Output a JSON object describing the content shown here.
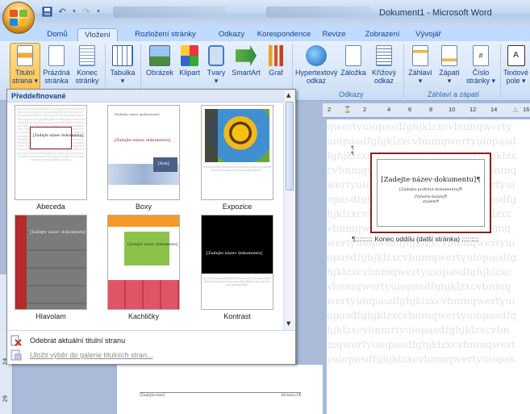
{
  "window": {
    "title": "Dokument1 - Microsoft Word"
  },
  "tabs": [
    {
      "label": "Domů"
    },
    {
      "label": "Vložení"
    },
    {
      "label": "Rozložení stránky"
    },
    {
      "label": "Odkazy"
    },
    {
      "label": "Korespondence"
    },
    {
      "label": "Revize"
    },
    {
      "label": "Zobrazení"
    },
    {
      "label": "Vývojář"
    }
  ],
  "ribbon": {
    "buttons": [
      {
        "line1": "Titulní",
        "line2": "strana ▾"
      },
      {
        "line1": "Prázdná",
        "line2": "stránka"
      },
      {
        "line1": "Konec",
        "line2": "stránky"
      },
      {
        "line1": "Tabulka",
        "line2": "▾"
      },
      {
        "line1": "Obrázek",
        "line2": ""
      },
      {
        "line1": "Klipart",
        "line2": ""
      },
      {
        "line1": "Tvary",
        "line2": "▾"
      },
      {
        "line1": "SmartArt",
        "line2": ""
      },
      {
        "line1": "Graf",
        "line2": ""
      },
      {
        "line1": "Hypertextový",
        "line2": "odkaz"
      },
      {
        "line1": "Záložka",
        "line2": ""
      },
      {
        "line1": "Křížový",
        "line2": "odkaz"
      },
      {
        "line1": "Záhlaví",
        "line2": "▾"
      },
      {
        "line1": "Zápatí",
        "line2": "▾"
      },
      {
        "line1": "Číslo",
        "line2": "stránky ▾"
      },
      {
        "line1": "Textové",
        "line2": "pole ▾"
      }
    ],
    "groups": [
      {
        "label": "Odkazy"
      },
      {
        "label": "Záhlaví a zápatí"
      }
    ]
  },
  "gallery": {
    "header": "Předdefinované",
    "items": [
      {
        "caption": "Abeceda"
      },
      {
        "caption": "Boxy"
      },
      {
        "caption": "Expozice"
      },
      {
        "caption": "Hlavolam"
      },
      {
        "caption": "Kachličky"
      },
      {
        "caption": "Kontrast"
      }
    ],
    "thumb_text": {
      "title": "[Zadejte název dokumentu]",
      "year": "[Rok]"
    },
    "menu": [
      {
        "label": "Odebrat aktuální titulní stranu",
        "enabled": true
      },
      {
        "label": "Uložit výběr do galerie titulních stran...",
        "enabled": false
      }
    ]
  },
  "ruler": {
    "marks": [
      "2",
      "2",
      "4",
      "6",
      "8",
      "10",
      "12",
      "14",
      "16"
    ]
  },
  "vruler": {
    "marks": [
      "24",
      "26"
    ]
  },
  "document": {
    "bg_lines": [
      "qwertyuiopasdfghjklzxcvbnmqwerty",
      "uiopasdfghjklzxcvbnmqwertyuiopasd",
      "fghjklzxcvbnmqwertyuiopasdfghjklzx",
      "cvbnmqwertyuiopasdfghjklzxcvbnmq",
      "wertyuiopasdfghjklzxcvbnmqwertyui",
      "opasdfghjklzxcvbnmqwertyuiopasdfg",
      "hjklzxcvbnmqwertyuiopasdfghjklzxc",
      "vbnmqwertyuiopasdfghjklzxcvbnmq",
      "wertyuiopasdfghjklzxcvbnmqwertyui",
      "opasdfghjklzxcvbnmqwertyuiopasdfg",
      "hjklzxcvbnmqwertyuiopasdfghjklzxc",
      "vbnmqwertyuiopasdfghjklzxcvbnmq",
      "wertyuiopasdfghjklzxcvbnmqwertyui",
      "opasdfghjklzxcvbnmqwertyuiopasdfg",
      "hjklzxcvbnmrtyuiopasdfghjklzxcvbn",
      "mqwertyuiopasdfghjklzxcvbnmqwert",
      "yuiopasdfghjklzxcvbnmqwertyuiopas"
    ],
    "cover_title": "[Zadejte·název·dokumentu]¶",
    "cover_subtitle": "[Zadejte·podtitul·dokumentu]¶",
    "cover_meta": "[Vyberte·datum]¶",
    "cover_author": "student¶",
    "section_break": "Konec oddílu (další stránka)",
    "footer_left": "[Zadejte·text]",
    "footer_right": "Stránka·1¶"
  },
  "colors": {
    "accent": "#15428b",
    "ribbon_bg": "#dae6f6",
    "selected": "#ffc350"
  }
}
